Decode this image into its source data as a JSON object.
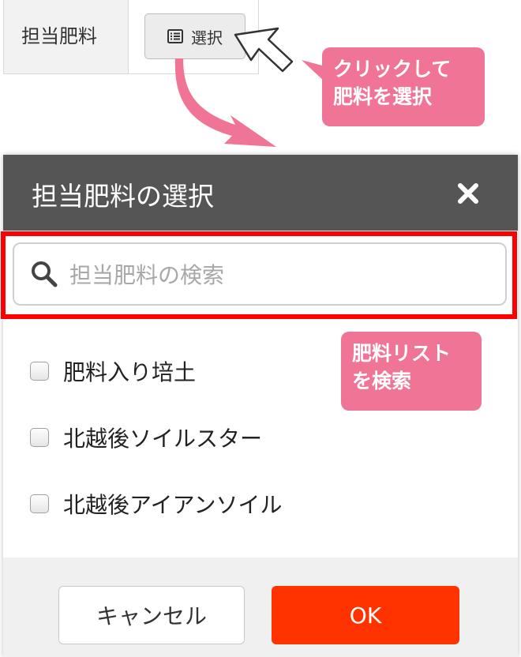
{
  "field": {
    "label": "担当肥料",
    "select_button_label": "選択"
  },
  "callouts": {
    "click": [
      "クリックして",
      "肥料を選択"
    ],
    "search": [
      "肥料リスト",
      "を検索"
    ]
  },
  "modal": {
    "title": "担当肥料の選択",
    "search_placeholder": "担当肥料の検索",
    "options": [
      {
        "label": "肥料入り培土",
        "checked": false
      },
      {
        "label": "北越後ソイルスター",
        "checked": false
      },
      {
        "label": "北越後アイアンソイル",
        "checked": false
      }
    ],
    "cancel_label": "キャンセル",
    "ok_label": "OK"
  },
  "colors": {
    "accent": "#ff3300",
    "callout": "#f07496",
    "header": "#555555",
    "highlight": "#ff0000"
  }
}
